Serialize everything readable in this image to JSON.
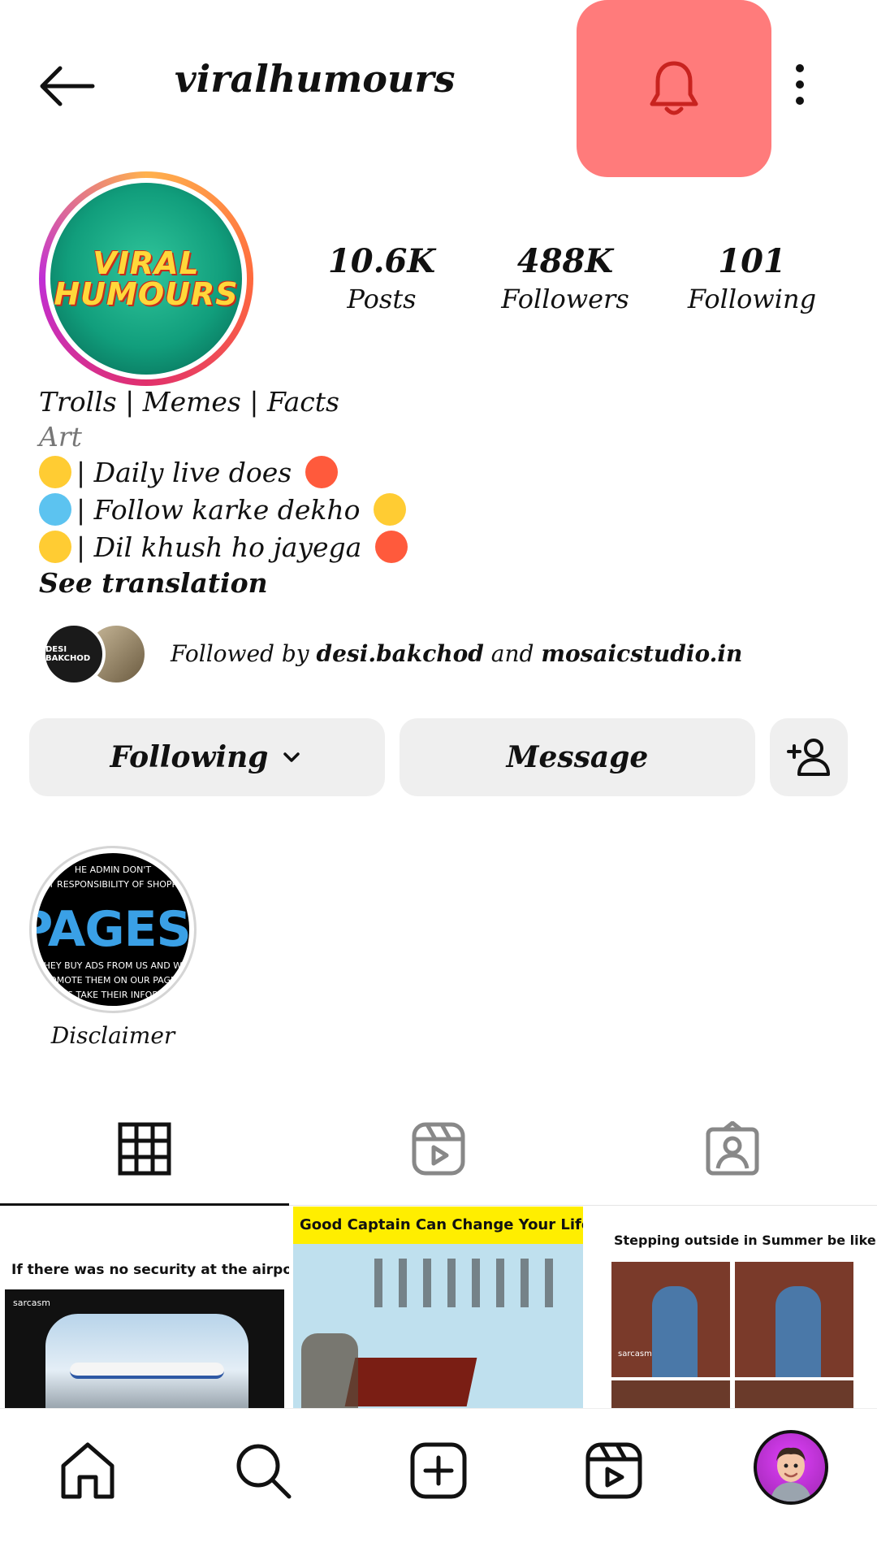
{
  "header": {
    "username": "viralhumours"
  },
  "profile": {
    "avatar_text_line1": "VIRAL",
    "avatar_text_line2": "HUMOURS",
    "stats": [
      {
        "value": "10.6K",
        "label": "Posts"
      },
      {
        "value": "488K",
        "label": "Followers"
      },
      {
        "value": "101",
        "label": "Following"
      }
    ]
  },
  "bio": {
    "line1": "Trolls | Memes | Facts",
    "line2": "Art",
    "line3": "| Daily live does",
    "line4": "| Follow karke dekho",
    "line5": "| Dil khush ho jayega",
    "see_translation": "See translation"
  },
  "followed_by": {
    "prefix": "Followed by",
    "user1": "desi.bakchod",
    "conj": "and",
    "user2": "mosaicstudio.in",
    "avatar1_text": "DESI BAKCHOD"
  },
  "actions": {
    "following_label": "Following",
    "message_label": "Message"
  },
  "highlight": {
    "label": "Disclaimer",
    "big_text": "PAGES.",
    "top1": "HE ADMIN DON'T",
    "top2": "Y RESPONSIBILITY OF SHOPP",
    "bot1": "THEY BUY ADS FROM US AND WE",
    "bot2": "OMOTE THEM ON OUR PAGE",
    "bot3": "S TAKE THEIR INFOR"
  },
  "posts": [
    {
      "caption": "If there was no security at the airport",
      "tag": "sarcasm"
    },
    {
      "caption": "Good Captain Can Change Your Life"
    },
    {
      "caption": "Stepping outside in Summer be like :",
      "tag": "sarcasm"
    }
  ],
  "colors": {
    "notify_highlight": "#ff7b7b",
    "button_bg": "#efefef"
  }
}
